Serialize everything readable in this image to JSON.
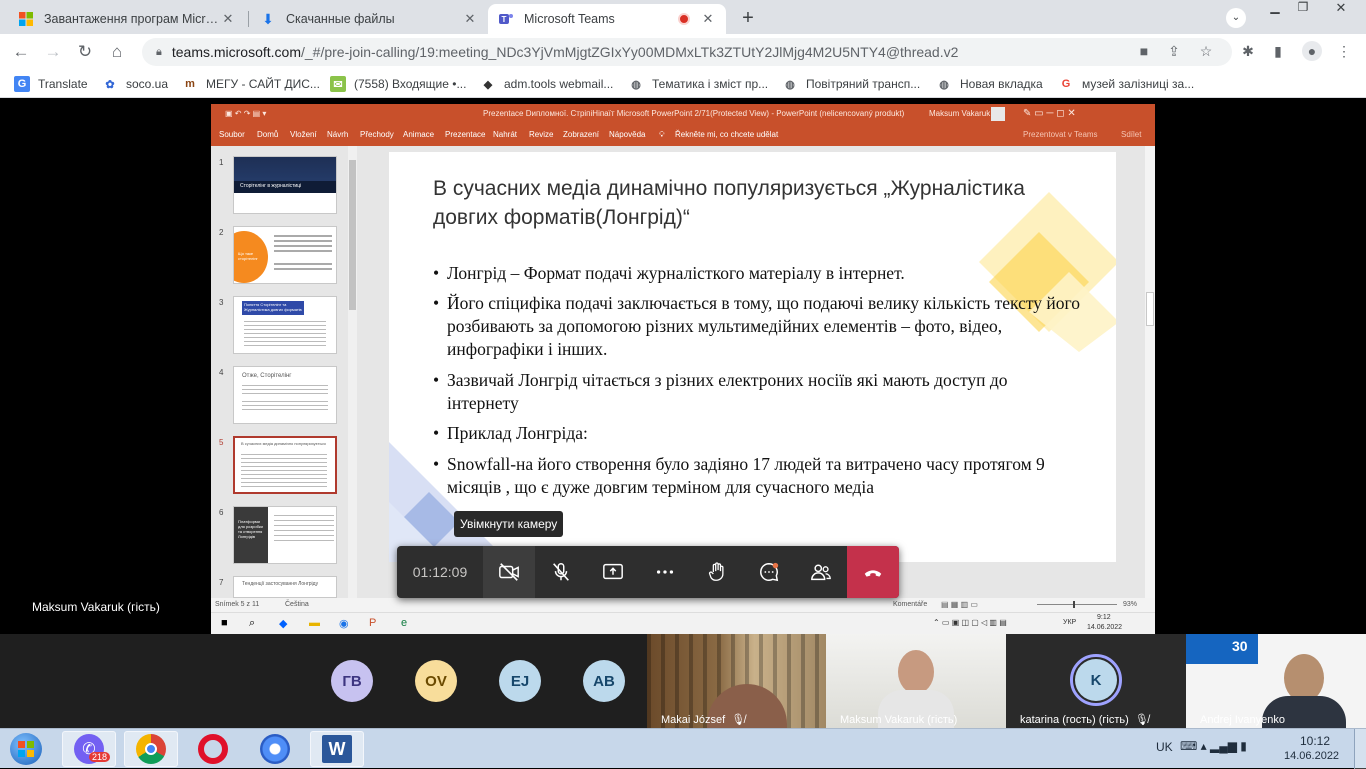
{
  "browser": {
    "tabs": [
      {
        "title": "Завантаження програм Microsoft",
        "icon": "ms-logo-icon",
        "active": false
      },
      {
        "title": "Скачанные файлы",
        "icon": "download-icon",
        "active": false
      },
      {
        "title": "Microsoft Teams",
        "icon": "teams-icon",
        "active": true
      }
    ],
    "new_tab": "+",
    "url_domain": "teams.microsoft.com",
    "url_path": "/_#/pre-join-calling/19:meeting_NDc3YjVmMjgtZGIxYy00MDMxLTk3ZTUtY2JlMjg4M2U5NTY4@thread.v2",
    "bookmarks": [
      {
        "label": "Translate",
        "icon": "translate-icon"
      },
      {
        "label": "soco.ua",
        "icon": "soco-icon"
      },
      {
        "label": "МЕГУ - САЙТ ДИС...",
        "icon": "megu-icon"
      },
      {
        "label": "(7558) Входящие •...",
        "icon": "mail-icon"
      },
      {
        "label": "adm.tools webmail...",
        "icon": "admtools-icon"
      },
      {
        "label": "Тематика і зміст пр...",
        "icon": "globe-icon"
      },
      {
        "label": "Повітряний трансп...",
        "icon": "globe-icon"
      },
      {
        "label": "Новая вкладка",
        "icon": "globe-icon"
      },
      {
        "label": "музей залізниці за...",
        "icon": "google-icon"
      }
    ]
  },
  "powerpoint": {
    "window_title": "Prezentace Dипломної. СтріпіНіпаїт Microsoft PowerPoint 2/71(Protected View) - PowerPoint (nelicencovaný produkt)",
    "user": "Maksum Vakaruk",
    "ribbon_tabs": [
      "Soubor",
      "Domů",
      "Vložení",
      "Návrh",
      "Přechody",
      "Animace",
      "Prezentace",
      "Nahrát",
      "Revize",
      "Zobrazení",
      "Nápověda"
    ],
    "tell_me": "Řekněte mi, co chcete udělat",
    "present_in_teams": "Prezentovat v Teams",
    "share": "Sdílet",
    "thumbnails": [
      {
        "num": "1",
        "title": "Сторітелінг в журналістиці"
      },
      {
        "num": "2",
        "title": "Що таке сторітелінг"
      },
      {
        "num": "3",
        "title": "Поняття Сторітелінг та Журналістика довгих форматів"
      },
      {
        "num": "4",
        "title": "Отже, Сторітелінг"
      },
      {
        "num": "5",
        "title": "В сучасних медіа динамічно популяризується"
      },
      {
        "num": "6",
        "title": "Платформи для розробки та створення Лонгрідів"
      },
      {
        "num": "7",
        "title": "Тенденції застосування Лонгріду"
      }
    ],
    "slide": {
      "title": "В сучасних медіа динамічно популяризується „Журналістика довгих форматів(Лонгрід)“",
      "bullets": [
        "Лонгрід – Формат подачі журналісткого матеріалу в інтернет.",
        "Його спіцифіка подачі заключається в тому, що подаючі велику кількість тексту його розбивають за допомогою різних мультимедійних елементів – фото, відео, инфографіки і інших.",
        "Зазвичай Лонгрід чітається з різних електроних носіїв які мають доступ до інтернету",
        "Приклад Лонгріда:",
        "Snowfall-на його створення було задіяно 17 людей та витрачено часу протягом 9 місяців , що є дуже довгим терміном для сучасного медіа"
      ]
    },
    "status": {
      "slide_of": "Snímek 5 z 11",
      "lang": "Čeština",
      "comments": "Komentáře",
      "zoom": "93%"
    },
    "inner_taskbar": {
      "lang": "УКР",
      "time": "9:12",
      "date": "14.06.2022"
    }
  },
  "call": {
    "timer": "01:12:09",
    "tooltip": "Увімкнути камеру",
    "presenter": "Maksum Vakaruk (гість)",
    "participants_avatars": [
      {
        "initials": "ГВ",
        "bg": "#c7c2f0",
        "fg": "#3d3580"
      },
      {
        "initials": "OV",
        "bg": "#f8dd9b",
        "fg": "#6b4a00"
      },
      {
        "initials": "EJ",
        "bg": "#bcd9ec",
        "fg": "#17476b"
      },
      {
        "initials": "AB",
        "bg": "#bcd9ec",
        "fg": "#17476b"
      }
    ],
    "video_tiles": [
      {
        "name": "Makai József",
        "muted": true
      },
      {
        "name": "Maksum Vakaruk (гість)",
        "muted": false
      },
      {
        "name": "katarina (гость) (гість)",
        "muted": true,
        "initials": "K"
      },
      {
        "name": "Andrej Ivanyenko",
        "muted": false,
        "banner": "30"
      }
    ]
  },
  "taskbar": {
    "viber_badge": "218",
    "lang": "UK",
    "time": "10:12",
    "date": "14.06.2022"
  },
  "colors": {
    "ppt_accent": "#c8502b",
    "teams_hangup": "#c4314b",
    "slide_shape_yellow": "#fde68a",
    "slide_shape_blue": "#c7d2f0"
  }
}
